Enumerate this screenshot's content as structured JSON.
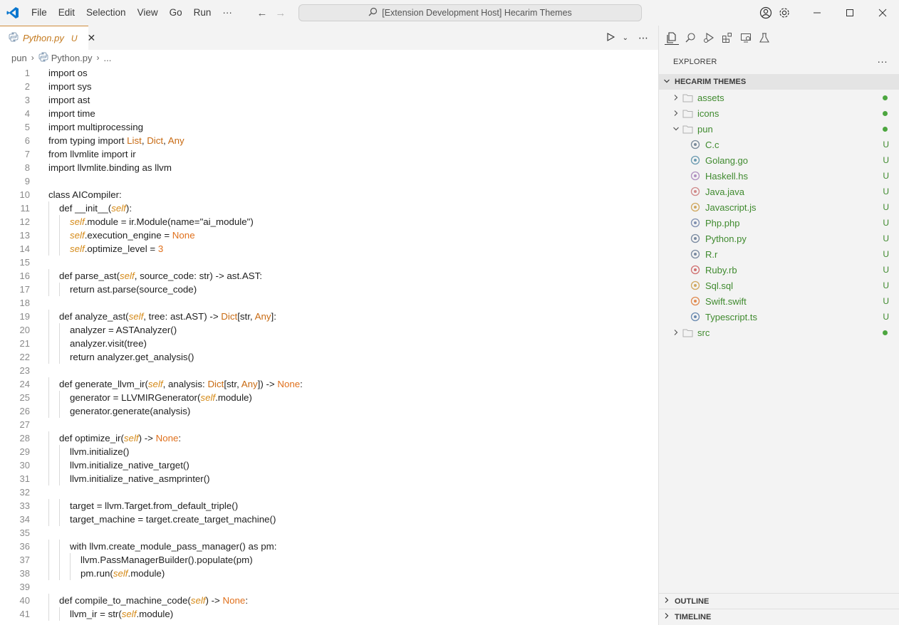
{
  "menu": [
    "File",
    "Edit",
    "Selection",
    "View",
    "Go",
    "Run",
    "···"
  ],
  "command_center": "[Extension Development Host] Hecarim Themes",
  "tab": {
    "label": "Python.py",
    "status": "U"
  },
  "breadcrumbs": [
    "pun",
    "Python.py",
    "..."
  ],
  "code_lines": [
    "import os",
    "import sys",
    "import ast",
    "import time",
    "import multiprocessing",
    "from typing import List, Dict, Any",
    "from llvmlite import ir",
    "import llvmlite.binding as llvm",
    "",
    "class AICompiler:",
    "    def __init__(self):",
    "        self.module = ir.Module(name=\"ai_module\")",
    "        self.execution_engine = None",
    "        self.optimize_level = 3",
    "",
    "    def parse_ast(self, source_code: str) -> ast.AST:",
    "        return ast.parse(source_code)",
    "",
    "    def analyze_ast(self, tree: ast.AST) -> Dict[str, Any]:",
    "        analyzer = ASTAnalyzer()",
    "        analyzer.visit(tree)",
    "        return analyzer.get_analysis()",
    "",
    "    def generate_llvm_ir(self, analysis: Dict[str, Any]) -> None:",
    "        generator = LLVMIRGenerator(self.module)",
    "        generator.generate(analysis)",
    "",
    "    def optimize_ir(self) -> None:",
    "        llvm.initialize()",
    "        llvm.initialize_native_target()",
    "        llvm.initialize_native_asmprinter()",
    "",
    "        target = llvm.Target.from_default_triple()",
    "        target_machine = target.create_target_machine()",
    "",
    "        with llvm.create_module_pass_manager() as pm:",
    "            llvm.PassManagerBuilder().populate(pm)",
    "            pm.run(self.module)",
    "",
    "    def compile_to_machine_code(self) -> None:",
    "        llvm_ir = str(self.module)"
  ],
  "explorer": {
    "title": "EXPLORER",
    "more": "···",
    "folder": "HECARIM THEMES",
    "items": [
      {
        "label": "assets",
        "type": "folder",
        "expanded": false,
        "indent": 0
      },
      {
        "label": "icons",
        "type": "folder",
        "expanded": false,
        "indent": 0
      },
      {
        "label": "pun",
        "type": "folder",
        "expanded": true,
        "indent": 0
      },
      {
        "label": "C.c",
        "type": "file",
        "status": "U",
        "icon": "c-icon",
        "color": "#7a8a9a"
      },
      {
        "label": "Golang.go",
        "type": "file",
        "status": "U",
        "icon": "go-icon",
        "color": "#6a9ab0"
      },
      {
        "label": "Haskell.hs",
        "type": "file",
        "status": "U",
        "icon": "haskell-icon",
        "color": "#b090c0"
      },
      {
        "label": "Java.java",
        "type": "file",
        "status": "U",
        "icon": "java-icon",
        "color": "#d08a8a"
      },
      {
        "label": "Javascript.js",
        "type": "file",
        "status": "U",
        "icon": "js-icon",
        "color": "#d0a860"
      },
      {
        "label": "Php.php",
        "type": "file",
        "status": "U",
        "icon": "php-icon",
        "color": "#8090b0"
      },
      {
        "label": "Python.py",
        "type": "file",
        "status": "U",
        "icon": "python-icon",
        "color": "#7a8aa0"
      },
      {
        "label": "R.r",
        "type": "file",
        "status": "U",
        "icon": "r-icon",
        "color": "#7a8aa0"
      },
      {
        "label": "Ruby.rb",
        "type": "file",
        "status": "U",
        "icon": "ruby-icon",
        "color": "#d07070"
      },
      {
        "label": "Sql.sql",
        "type": "file",
        "status": "U",
        "icon": "database-icon",
        "color": "#d0a860"
      },
      {
        "label": "Swift.swift",
        "type": "file",
        "status": "U",
        "icon": "swift-icon",
        "color": "#e08a50"
      },
      {
        "label": "Typescript.ts",
        "type": "file",
        "status": "U",
        "icon": "ts-icon",
        "color": "#6a8ab0"
      },
      {
        "label": "src",
        "type": "folder",
        "expanded": false,
        "indent": 0
      }
    ]
  },
  "bottom_sections": [
    "OUTLINE",
    "TIMELINE"
  ],
  "colors": {
    "accent": "#c47a1f",
    "untracked": "#3f8a2e",
    "vscode_blue": "#0a77cf"
  }
}
